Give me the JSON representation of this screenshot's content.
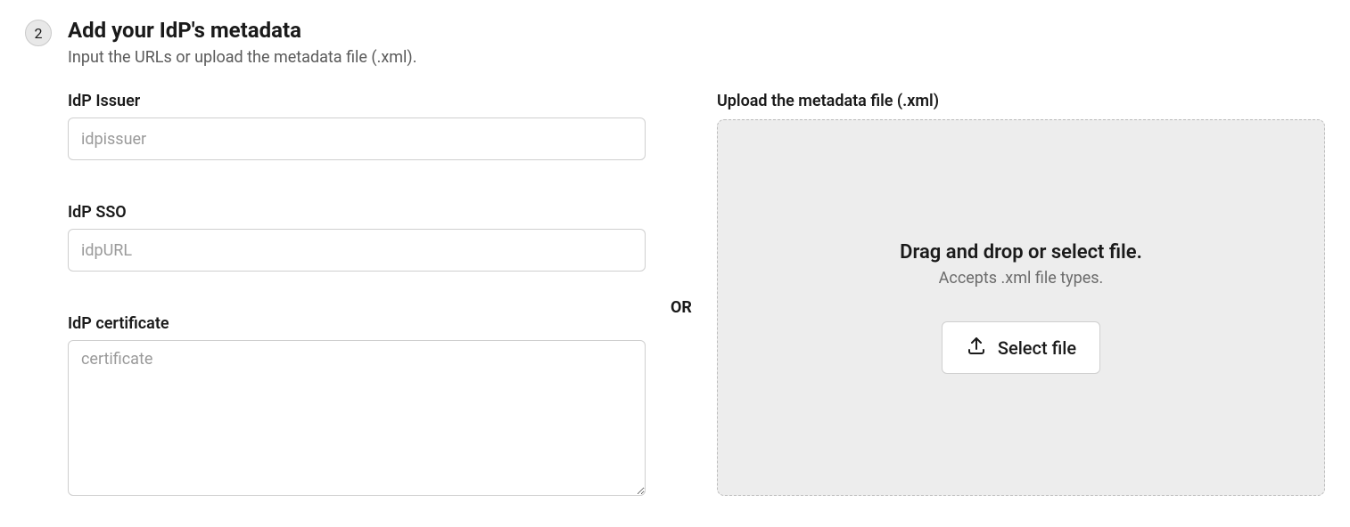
{
  "step": {
    "number": "2",
    "title": "Add your IdP's metadata",
    "subtitle": "Input the URLs or upload the metadata file (.xml)."
  },
  "fields": {
    "issuer": {
      "label": "IdP Issuer",
      "placeholder": "idpissuer",
      "value": ""
    },
    "sso": {
      "label": "IdP SSO",
      "placeholder": "idpURL",
      "value": ""
    },
    "certificate": {
      "label": "IdP certificate",
      "placeholder": "certificate",
      "value": ""
    }
  },
  "divider": "OR",
  "upload": {
    "label": "Upload the metadata file (.xml)",
    "primary": "Drag and drop or select file.",
    "secondary": "Accepts .xml file types.",
    "button": "Select file"
  }
}
